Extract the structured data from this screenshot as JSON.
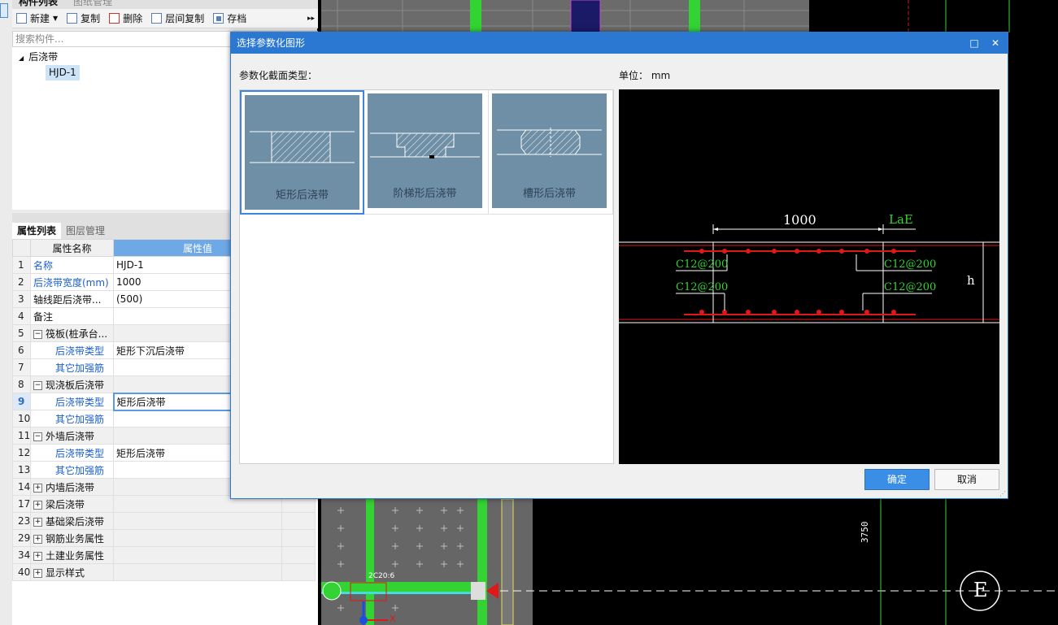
{
  "left_panel": {
    "top_tabs": [
      "构件列表",
      "图纸管理"
    ],
    "toolbar": {
      "new_label": "新建",
      "copy_label": "复制",
      "delete_label": "删除",
      "floor_copy_label": "层间复制",
      "save_label": "存档",
      "more_label": "▸▸"
    },
    "search_placeholder": "搜索构件...",
    "tree": {
      "root_label": "后浇带",
      "child_label": "HJD-1"
    },
    "prop_tabs": [
      "属性列表",
      "图层管理"
    ],
    "prop_headers": {
      "name": "属性名称",
      "value": "属性值"
    },
    "rows": [
      {
        "num": "1",
        "name": "名称",
        "value": "HJD-1",
        "style": "blue"
      },
      {
        "num": "2",
        "name": "后浇带宽度(mm)",
        "value": "1000",
        "style": "blue"
      },
      {
        "num": "3",
        "name": "轴线距后浇带...",
        "value": "(500)",
        "style": ""
      },
      {
        "num": "4",
        "name": "备注",
        "value": "",
        "style": ""
      },
      {
        "num": "5",
        "name": "筏板(桩承台...",
        "value": "",
        "style": "group",
        "toggle": "−"
      },
      {
        "num": "6",
        "name": "后浇带类型",
        "value": "矩形下沉后浇带",
        "style": "child"
      },
      {
        "num": "7",
        "name": "其它加强筋",
        "value": "",
        "style": "child"
      },
      {
        "num": "8",
        "name": "现浇板后浇带",
        "value": "",
        "style": "group",
        "toggle": "−"
      },
      {
        "num": "9",
        "name": "后浇带类型",
        "value": "矩形后浇带",
        "style": "child-sel"
      },
      {
        "num": "10",
        "name": "其它加强筋",
        "value": "",
        "style": "child"
      },
      {
        "num": "11",
        "name": "外墙后浇带",
        "value": "",
        "style": "group",
        "toggle": "−"
      },
      {
        "num": "12",
        "name": "后浇带类型",
        "value": "矩形后浇带",
        "style": "child"
      },
      {
        "num": "13",
        "name": "其它加强筋",
        "value": "",
        "style": "child"
      },
      {
        "num": "14",
        "name": "内墙后浇带",
        "value": "",
        "style": "group",
        "toggle": "+"
      },
      {
        "num": "17",
        "name": "梁后浇带",
        "value": "",
        "style": "group",
        "toggle": "+"
      },
      {
        "num": "23",
        "name": "基础梁后浇带",
        "value": "",
        "style": "group",
        "toggle": "+"
      },
      {
        "num": "29",
        "name": "钢筋业务属性",
        "value": "",
        "style": "group",
        "toggle": "+"
      },
      {
        "num": "34",
        "name": "土建业务属性",
        "value": "",
        "style": "group",
        "toggle": "+"
      },
      {
        "num": "40",
        "name": "显示样式",
        "value": "",
        "style": "group",
        "toggle": "+"
      }
    ]
  },
  "cad": {
    "dim_label": "3750",
    "axis_bubble": "E",
    "rebar_label": "2C20:6",
    "axis_x": "X",
    "grid_color": "#32d332"
  },
  "dialog": {
    "title": "选择参数化图形",
    "section_label": "参数化截面类型：",
    "unit_label": "单位：  mm",
    "thumbs": [
      {
        "caption": "矩形后浇带",
        "shape": "rect"
      },
      {
        "caption": "阶梯形后浇带",
        "shape": "step"
      },
      {
        "caption": "槽形后浇带",
        "shape": "groove"
      }
    ],
    "preview": {
      "dim_width": "1000",
      "dim_lae": "LaE",
      "rebar_tl": "C12@200",
      "rebar_tr": "C12@200",
      "rebar_bl": "C12@200",
      "rebar_br": "C12@200",
      "h_label": "h"
    },
    "ok_label": "确定",
    "cancel_label": "取消",
    "accent_color": "#2b78d3"
  }
}
